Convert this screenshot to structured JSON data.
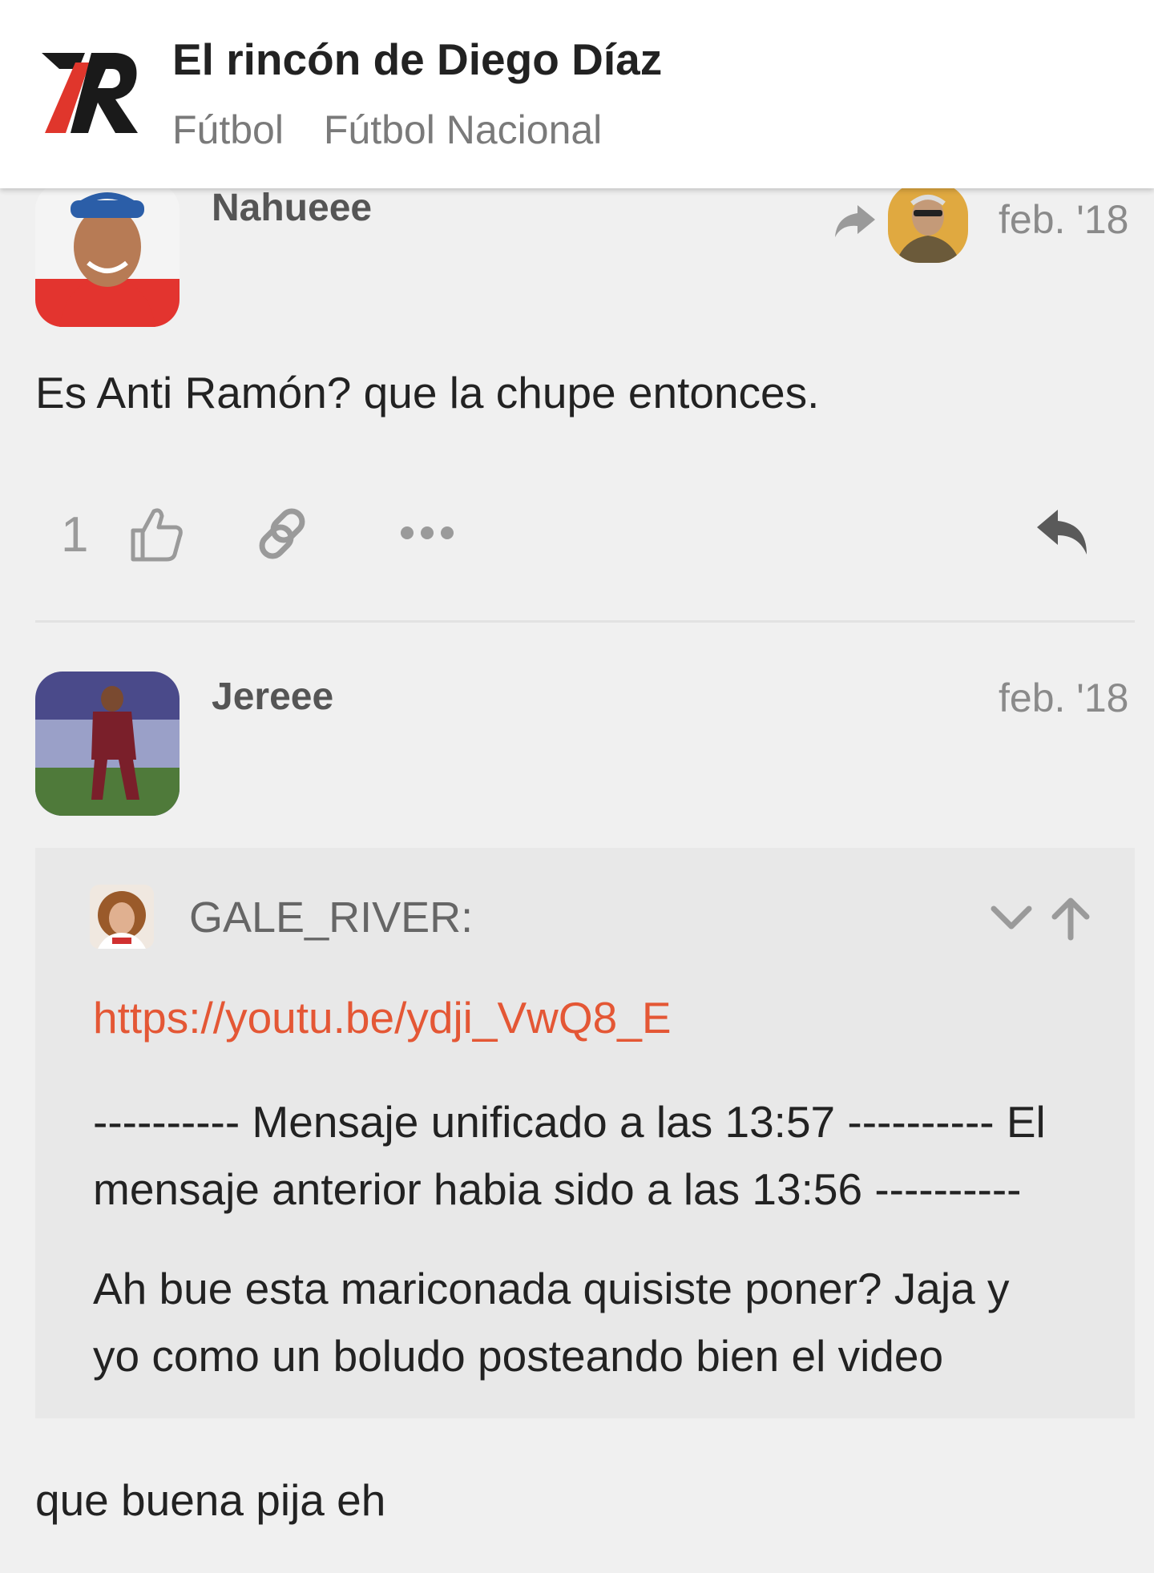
{
  "header": {
    "title": "El rincón de Diego Díaz",
    "breadcrumbs": [
      "Fútbol",
      "Fútbol Nacional"
    ],
    "logo_colors": {
      "red": "#e0362c",
      "black": "#1a1a1a"
    }
  },
  "posts": [
    {
      "username": "Nahueee",
      "date": "feb. '18",
      "reply_to_indicator": "reply-arrow-icon",
      "text": "Es Anti Ramón? que la chupe entonces.",
      "likes": "1"
    },
    {
      "username": "Jereee",
      "date": "feb. '18",
      "quote": {
        "author": "GALE_RIVER:",
        "link": "https://youtu.be/ydji_VwQ8_E",
        "paragraph1_line1": "---------- Mensaje unificado a las 13:57 ---------- El",
        "paragraph1_line2": "mensaje anterior habia sido a las 13:56 ----------",
        "paragraph2_line1": "Ah bue esta mariconada quisiste poner? Jaja y",
        "paragraph2_line2": "yo como un boludo posteando bien el video"
      },
      "text": "que buena pija eh"
    }
  ],
  "colors": {
    "background": "#f0f0f0",
    "link": "#e45735",
    "muted": "#8a8a8a"
  }
}
